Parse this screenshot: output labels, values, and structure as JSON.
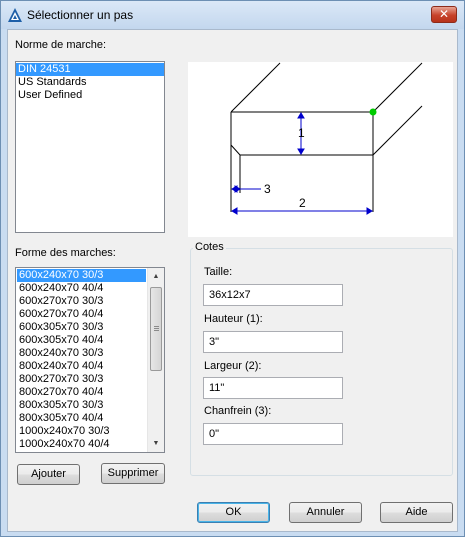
{
  "window": {
    "title": "Sélectionner un pas",
    "close_label": "✕"
  },
  "norme": {
    "label": "Norme de marche:",
    "items": [
      "DIN 24531",
      "US Standards",
      "User Defined"
    ],
    "selected_index": 0
  },
  "forme": {
    "label": "Forme des marches:",
    "items": [
      "600x240x70 30/3",
      "600x240x70 40/4",
      "600x270x70 30/3",
      "600x270x70 40/4",
      "600x305x70 30/3",
      "600x305x70 40/4",
      "800x240x70 30/3",
      "800x240x70 40/4",
      "800x270x70 30/3",
      "800x270x70 40/4",
      "800x305x70 30/3",
      "800x305x70 40/4",
      "1000x240x70 30/3",
      "1000x240x70 40/4"
    ],
    "selected_index": 0
  },
  "diagram": {
    "label_1": "1",
    "label_2": "2",
    "label_3": "3",
    "marker_color": "#00cc00",
    "dim_color": "#0000cc"
  },
  "cotes": {
    "legend": "Cotes",
    "taille_label": "Taille:",
    "taille_value": "36x12x7",
    "hauteur_label": "Hauteur (1):",
    "hauteur_value": "3\"",
    "largeur_label": "Largeur (2):",
    "largeur_value": "11\"",
    "chanfrein_label": "Chanfrein (3):",
    "chanfrein_value": "0\""
  },
  "buttons": {
    "ajouter": "Ajouter",
    "supprimer": "Supprimer",
    "ok": "OK",
    "annuler": "Annuler",
    "aide": "Aide"
  }
}
